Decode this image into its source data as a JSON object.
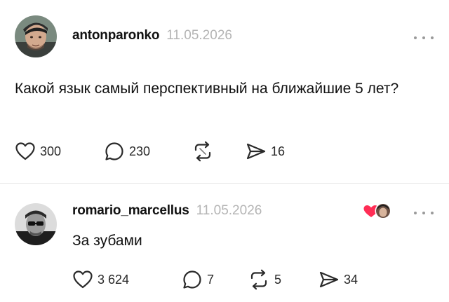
{
  "main_post": {
    "username": "antonparonko",
    "date": "11.05.2026",
    "text": "Какой язык самый перспективный на ближайшие 5 лет?",
    "actions": {
      "likes": "300",
      "comments": "230",
      "reposts": "",
      "shares": "16"
    },
    "icons": {
      "like": "heart-icon",
      "comment": "speech-bubble-icon",
      "repost": "repost-icon",
      "share": "send-icon",
      "more": "more-dots-icon"
    }
  },
  "reply": {
    "username": "romario_marcellus",
    "date": "11.05.2026",
    "text": "За зубами",
    "actions": {
      "likes": "3 624",
      "comments": "7",
      "reposts": "5",
      "shares": "34"
    },
    "badge": "liked-by-author-badge"
  },
  "colors": {
    "text": "#111111",
    "muted": "#b4b4b4",
    "divider": "#e6e6e6",
    "accent_heart": "#ff2d55"
  }
}
